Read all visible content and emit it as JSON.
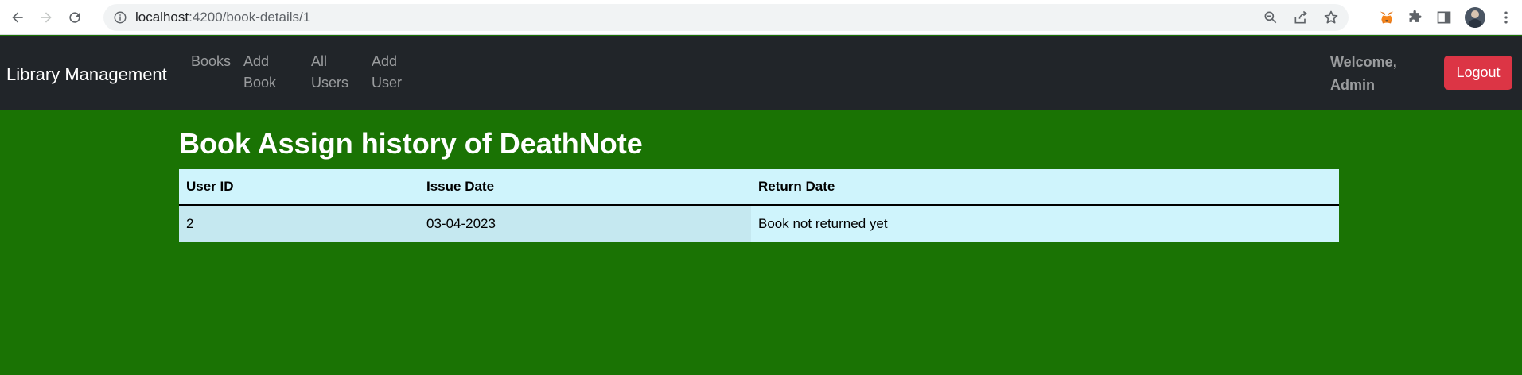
{
  "browser": {
    "url_host": "localhost",
    "url_path": ":4200/book-details/1",
    "icons": [
      "back-icon",
      "forward-icon",
      "reload-icon",
      "info-icon",
      "zoom-icon",
      "share-icon",
      "star-icon",
      "metamask-fox-icon",
      "extensions-puzzle-icon",
      "side-panel-icon",
      "profile-avatar",
      "more-vert-icon"
    ]
  },
  "navbar": {
    "brand": "Library Management",
    "links": [
      {
        "line1": "Books",
        "line2": ""
      },
      {
        "line1": "Add",
        "line2": "Book"
      },
      {
        "line1": "All",
        "line2": "Users"
      },
      {
        "line1": "Add",
        "line2": "User"
      }
    ],
    "welcome_line1": "Welcome,",
    "welcome_line2": "Admin",
    "logout_label": "Logout"
  },
  "main": {
    "title": "Book Assign history of DeathNote",
    "table": {
      "headers": [
        "User ID",
        "Issue Date",
        "Return Date"
      ],
      "rows": [
        [
          "2",
          "03-04-2023",
          "Book not returned yet"
        ]
      ]
    }
  },
  "colors": {
    "page_bg": "#1a7304",
    "navbar_bg": "#212529",
    "logout_bg": "#dc3545",
    "table_header_bg": "#cff4fc"
  }
}
